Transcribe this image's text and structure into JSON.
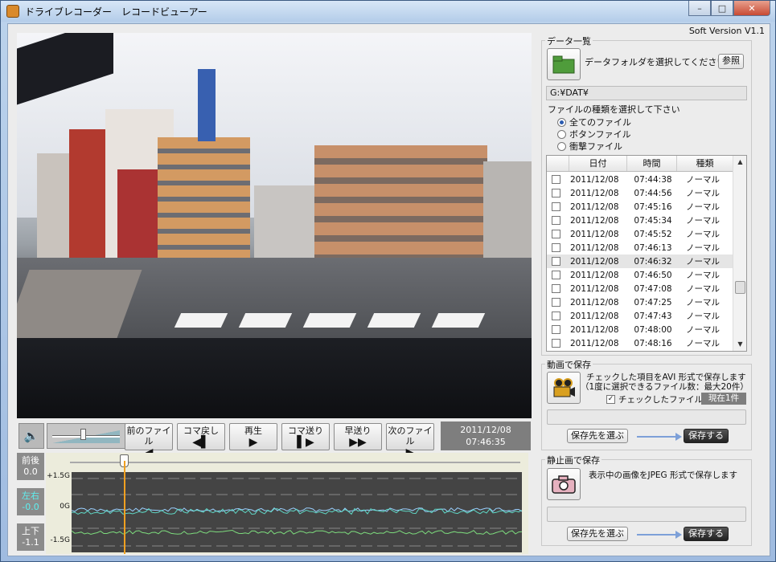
{
  "window": {
    "title": "ドライブレコーダー　レコードビューアー",
    "controls": {
      "minimize": "–",
      "maximize": "□",
      "close": "✕"
    },
    "icon": "app-icon"
  },
  "version": "Soft Version V1.1",
  "video": {
    "description_icon": "video-frame"
  },
  "playback": {
    "buttons": [
      {
        "label": "前のファイル",
        "glyph": "◀"
      },
      {
        "label": "コマ戻し",
        "glyph": "◀▌"
      },
      {
        "label": "再生",
        "glyph": "▶"
      },
      {
        "label": "コマ送り",
        "glyph": "▌▶"
      },
      {
        "label": "早送り",
        "glyph": "▶▶"
      },
      {
        "label": "次のファイル",
        "glyph": "▶"
      }
    ],
    "date": "2011/12/08",
    "time": "07:46:35",
    "volume_level": 0.45
  },
  "gauges": [
    {
      "label": "前後",
      "value": "0.0"
    },
    {
      "label": "左右",
      "value": "-0.0"
    },
    {
      "label": "上下",
      "value": "-1.1"
    }
  ],
  "graph": {
    "y_labels": [
      "+1.5G",
      "0G",
      "-1.5G"
    ],
    "seek_position": 0.12
  },
  "data_list": {
    "group_title": "データ一覧",
    "select_folder_text": "データフォルダを選択してください",
    "browse_label": "参照",
    "path": "G:¥DAT¥",
    "file_type_prompt": "ファイルの種類を選択して下さい",
    "file_types": [
      {
        "label": "全てのファイル",
        "selected": true
      },
      {
        "label": "ボタンファイル",
        "selected": false
      },
      {
        "label": "衝撃ファイル",
        "selected": false
      }
    ],
    "columns": [
      "日付",
      "時間",
      "種類"
    ],
    "rows": [
      {
        "date": "2011/12/08",
        "time": "07:44:38",
        "type": "ノーマル"
      },
      {
        "date": "2011/12/08",
        "time": "07:44:56",
        "type": "ノーマル"
      },
      {
        "date": "2011/12/08",
        "time": "07:45:16",
        "type": "ノーマル"
      },
      {
        "date": "2011/12/08",
        "time": "07:45:34",
        "type": "ノーマル"
      },
      {
        "date": "2011/12/08",
        "time": "07:45:52",
        "type": "ノーマル"
      },
      {
        "date": "2011/12/08",
        "time": "07:46:13",
        "type": "ノーマル"
      },
      {
        "date": "2011/12/08",
        "time": "07:46:32",
        "type": "ノーマル"
      },
      {
        "date": "2011/12/08",
        "time": "07:46:50",
        "type": "ノーマル"
      },
      {
        "date": "2011/12/08",
        "time": "07:47:08",
        "type": "ノーマル"
      },
      {
        "date": "2011/12/08",
        "time": "07:47:25",
        "type": "ノーマル"
      },
      {
        "date": "2011/12/08",
        "time": "07:47:43",
        "type": "ノーマル"
      },
      {
        "date": "2011/12/08",
        "time": "07:48:00",
        "type": "ノーマル"
      },
      {
        "date": "2011/12/08",
        "time": "07:48:16",
        "type": "ノーマル"
      }
    ]
  },
  "video_save": {
    "group_title": "動画で保存",
    "desc1": "チェックした項目をAVI 形式で保存します",
    "desc2": "（1度に選択できるファイル数：最大20件）",
    "checked_label": "チェックしたファイル数",
    "current_count": "現在1件",
    "choose_dest": "保存先を選ぶ",
    "save": "保存する"
  },
  "still_save": {
    "group_title": "静止画で保存",
    "desc": "表示中の画像をJPEG 形式で保存します",
    "choose_dest": "保存先を選ぶ",
    "save": "保存する"
  }
}
